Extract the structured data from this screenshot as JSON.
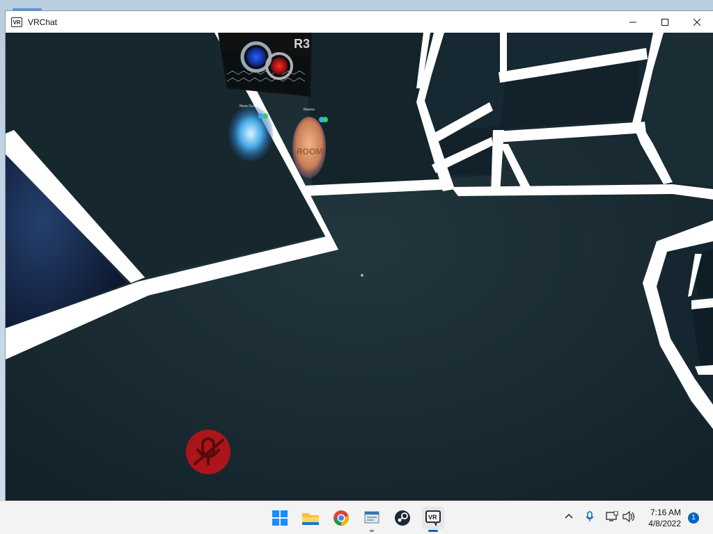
{
  "window": {
    "title": "VRChat",
    "app_icon_text": "VR",
    "controls": [
      "minimize-icon",
      "maximize-icon",
      "close-icon"
    ]
  },
  "scene": {
    "signboard_text": "R3",
    "portal_1_label": "Nova Ocean",
    "portal_2_label": "Rooms",
    "portal_2_sign": "ROOM",
    "muted_mic_icon": "mic-muted-icon"
  },
  "taskbar": {
    "apps": [
      {
        "name": "start-button",
        "icon": "windows-logo-icon"
      },
      {
        "name": "file-explorer",
        "icon": "folder-icon"
      },
      {
        "name": "chrome",
        "icon": "chrome-icon"
      },
      {
        "name": "app-window",
        "icon": "window-app-icon"
      },
      {
        "name": "steam",
        "icon": "steam-icon"
      },
      {
        "name": "vrchat",
        "icon": "vrchat-icon",
        "label": "VR",
        "active": true
      }
    ],
    "tray": {
      "time": "7:16 AM",
      "date": "4/8/2022",
      "notification_count": "1"
    }
  },
  "colors": {
    "taskbar_bg": "#f3f3f3",
    "accent": "#0067c0",
    "scene_floor": "#15242b",
    "scene_frame": "#ffffff",
    "mute_red": "#b8141a"
  }
}
